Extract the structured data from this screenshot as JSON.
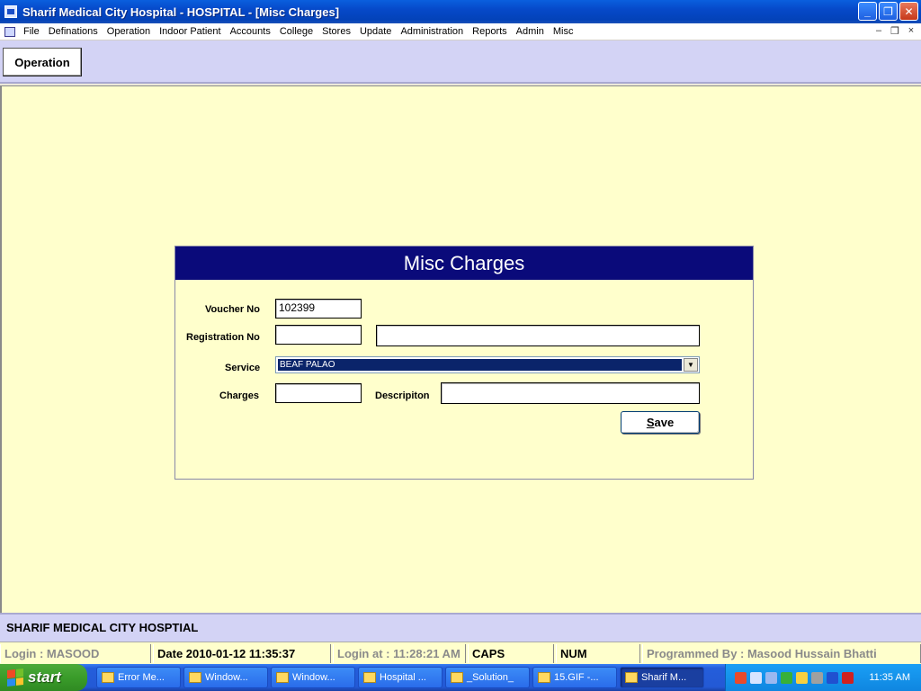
{
  "window": {
    "title": "Sharif Medical City Hospital - HOSPITAL - [Misc Charges]",
    "controls": [
      "minimize",
      "restore",
      "close"
    ]
  },
  "menu": {
    "items": [
      "File",
      "Definations",
      "Operation",
      "Indoor Patient",
      "Accounts",
      "College",
      "Stores",
      "Update",
      "Administration",
      "Reports",
      "Admin",
      "Misc"
    ],
    "mdi_controls": [
      "–",
      "❐",
      "×"
    ]
  },
  "toolbar": {
    "operation_label": "Operation"
  },
  "form": {
    "title": "Misc Charges",
    "voucher_label": "Voucher No",
    "voucher_value": "102399",
    "registration_label": "Registration No",
    "registration_value": "",
    "patient_name_value": "",
    "service_label": "Service",
    "service_value": "BEAF PALAO",
    "charges_label": "Charges",
    "charges_value": "",
    "description_label": "Descripiton",
    "description_value": "",
    "save_label_underlined": "S",
    "save_label_rest": "ave"
  },
  "footer": {
    "hospital_name": "SHARIF MEDICAL CITY HOSPTIAL"
  },
  "status": {
    "login": "Login :  MASOOD",
    "date": "Date 2010-01-12 11:35:37",
    "login_at": "Login at : 11:28:21 AM",
    "caps": "CAPS",
    "num": "NUM",
    "programmed_by": "Programmed By : Masood Hussain Bhatti"
  },
  "taskbar": {
    "start_label": "start",
    "tasks": [
      "Error Me...",
      "Window...",
      "Window...",
      "Hospital ...",
      "_Solution_",
      "15.GIF -...",
      "Sharif M..."
    ],
    "active_task_index": 6,
    "clock": "11:35 AM"
  },
  "colors": {
    "form_header": "#0a0a7a",
    "workspace": "#ffffcc",
    "strip": "#d3d3f5",
    "selection": "#0a246a"
  }
}
